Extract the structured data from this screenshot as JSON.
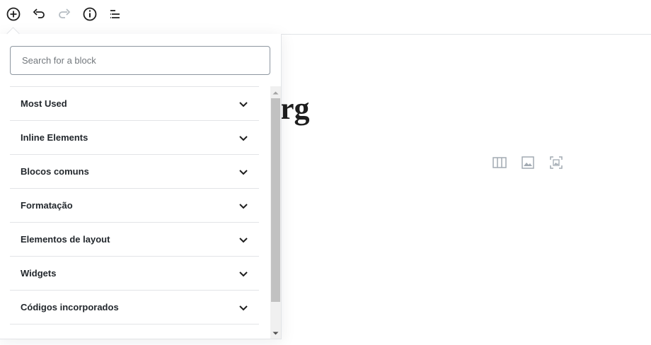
{
  "toolbar": {
    "icons": [
      "add-block-icon",
      "undo-icon",
      "redo-icon",
      "info-icon",
      "outline-icon"
    ]
  },
  "editor": {
    "title_fragment": "rg",
    "block_icons": [
      "columns-icon",
      "image-icon",
      "gallery-icon"
    ]
  },
  "inserter": {
    "search": {
      "placeholder": "Search for a block",
      "value": ""
    },
    "categories": [
      {
        "label": "Most Used"
      },
      {
        "label": "Inline Elements"
      },
      {
        "label": "Blocos comuns"
      },
      {
        "label": "Formatação"
      },
      {
        "label": "Elementos de layout"
      },
      {
        "label": "Widgets"
      },
      {
        "label": "Códigos incorporados"
      }
    ]
  },
  "colors": {
    "text": "#23282d",
    "border": "#e2e4e7",
    "icon": "#555d66",
    "icon_disabled": "#b5bcc2",
    "placeholder_icon": "#a2aab2",
    "scroll_track": "#f0f0f0",
    "scroll_thumb": "#c1c1c1"
  }
}
